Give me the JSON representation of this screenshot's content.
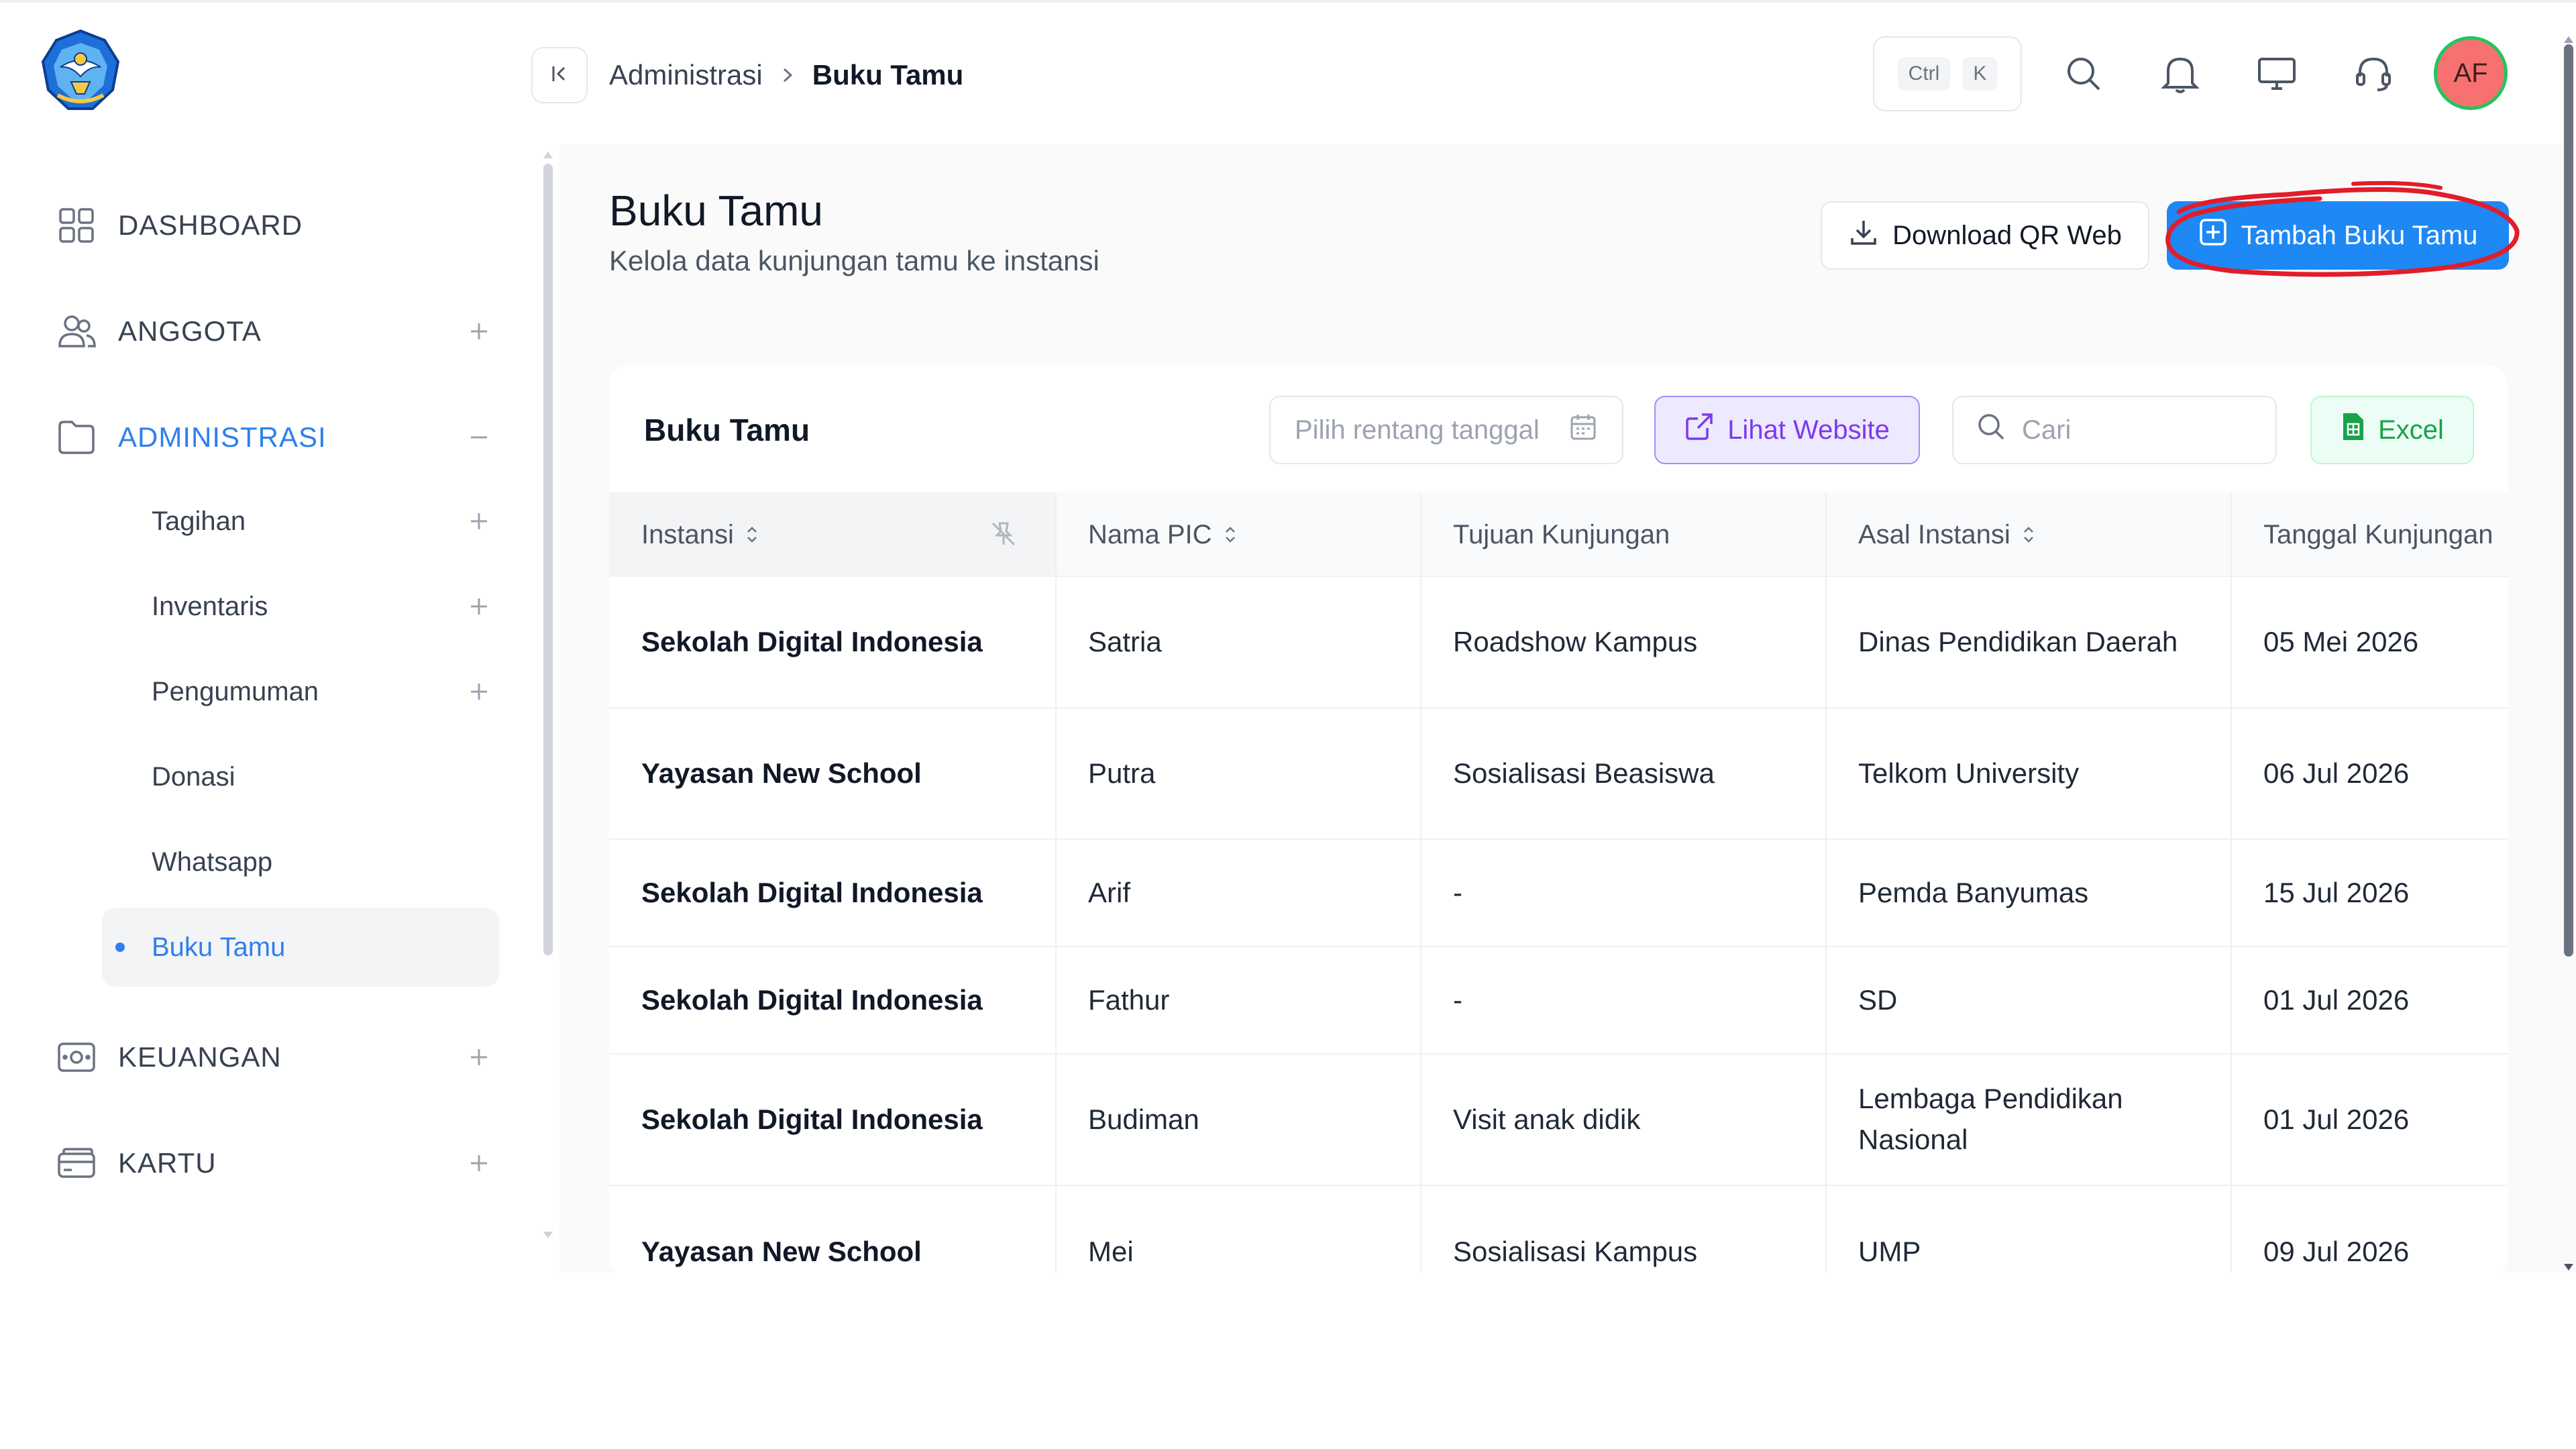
{
  "sidebar": {
    "items": [
      {
        "label": "DASHBOARD",
        "icon": "grid-icon"
      },
      {
        "label": "ANGGOTA",
        "icon": "users-icon",
        "toggle": "+"
      },
      {
        "label": "ADMINISTRASI",
        "icon": "folder-icon",
        "toggle": "−",
        "active": true
      },
      {
        "label": "KEUANGAN",
        "icon": "money-icon",
        "toggle": "+"
      },
      {
        "label": "KARTU",
        "icon": "card-icon",
        "toggle": "+"
      }
    ],
    "sub_items": [
      {
        "label": "Tagihan",
        "toggle": "+"
      },
      {
        "label": "Inventaris",
        "toggle": "+"
      },
      {
        "label": "Pengumuman",
        "toggle": "+"
      },
      {
        "label": "Donasi"
      },
      {
        "label": "Whatsapp"
      },
      {
        "label": "Buku Tamu",
        "active": true
      }
    ]
  },
  "topbar": {
    "breadcrumb_root": "Administrasi",
    "breadcrumb_current": "Buku Tamu",
    "shortcut_keys": [
      "Ctrl",
      "K"
    ],
    "avatar_initials": "AF"
  },
  "page": {
    "title": "Buku Tamu",
    "subtitle": "Kelola data kunjungan tamu ke instansi",
    "download_button": "Download QR Web",
    "primary_button": "Tambah Buku Tamu"
  },
  "card": {
    "title": "Buku Tamu",
    "date_placeholder": "Pilih rentang tanggal",
    "website_button": "Lihat Website",
    "search_placeholder": "Cari",
    "excel_button": "Excel"
  },
  "table": {
    "columns": [
      "Instansi",
      "Nama PIC",
      "Tujuan Kunjungan",
      "Asal Instansi",
      "Tanggal Kunjungan"
    ],
    "rows": [
      [
        "Sekolah Digital Indonesia",
        "Satria",
        "Roadshow Kampus",
        "Dinas Pendidikan Daerah",
        "05 Mei 2026"
      ],
      [
        "Yayasan New School",
        "Putra",
        "Sosialisasi Beasiswa",
        "Telkom University",
        "06 Jul 2026"
      ],
      [
        "Sekolah Digital Indonesia",
        "Arif",
        "-",
        "Pemda Banyumas",
        "15 Jul 2026"
      ],
      [
        "Sekolah Digital Indonesia",
        "Fathur",
        "-",
        "SD",
        "01 Jul 2026"
      ],
      [
        "Sekolah Digital Indonesia",
        "Budiman",
        "Visit anak didik",
        "Lembaga Pendidikan Nasional",
        "01 Jul 2026"
      ],
      [
        "Yayasan New School",
        "Mei",
        "Sosialisasi Kampus",
        "UMP",
        "09 Jul 2026"
      ]
    ]
  },
  "colors": {
    "accent": "#2f80ed",
    "primary_button": "#1e88f5",
    "annotation": "#e11d2a",
    "website_button": "#7c3aed",
    "excel_button": "#16a34a"
  }
}
